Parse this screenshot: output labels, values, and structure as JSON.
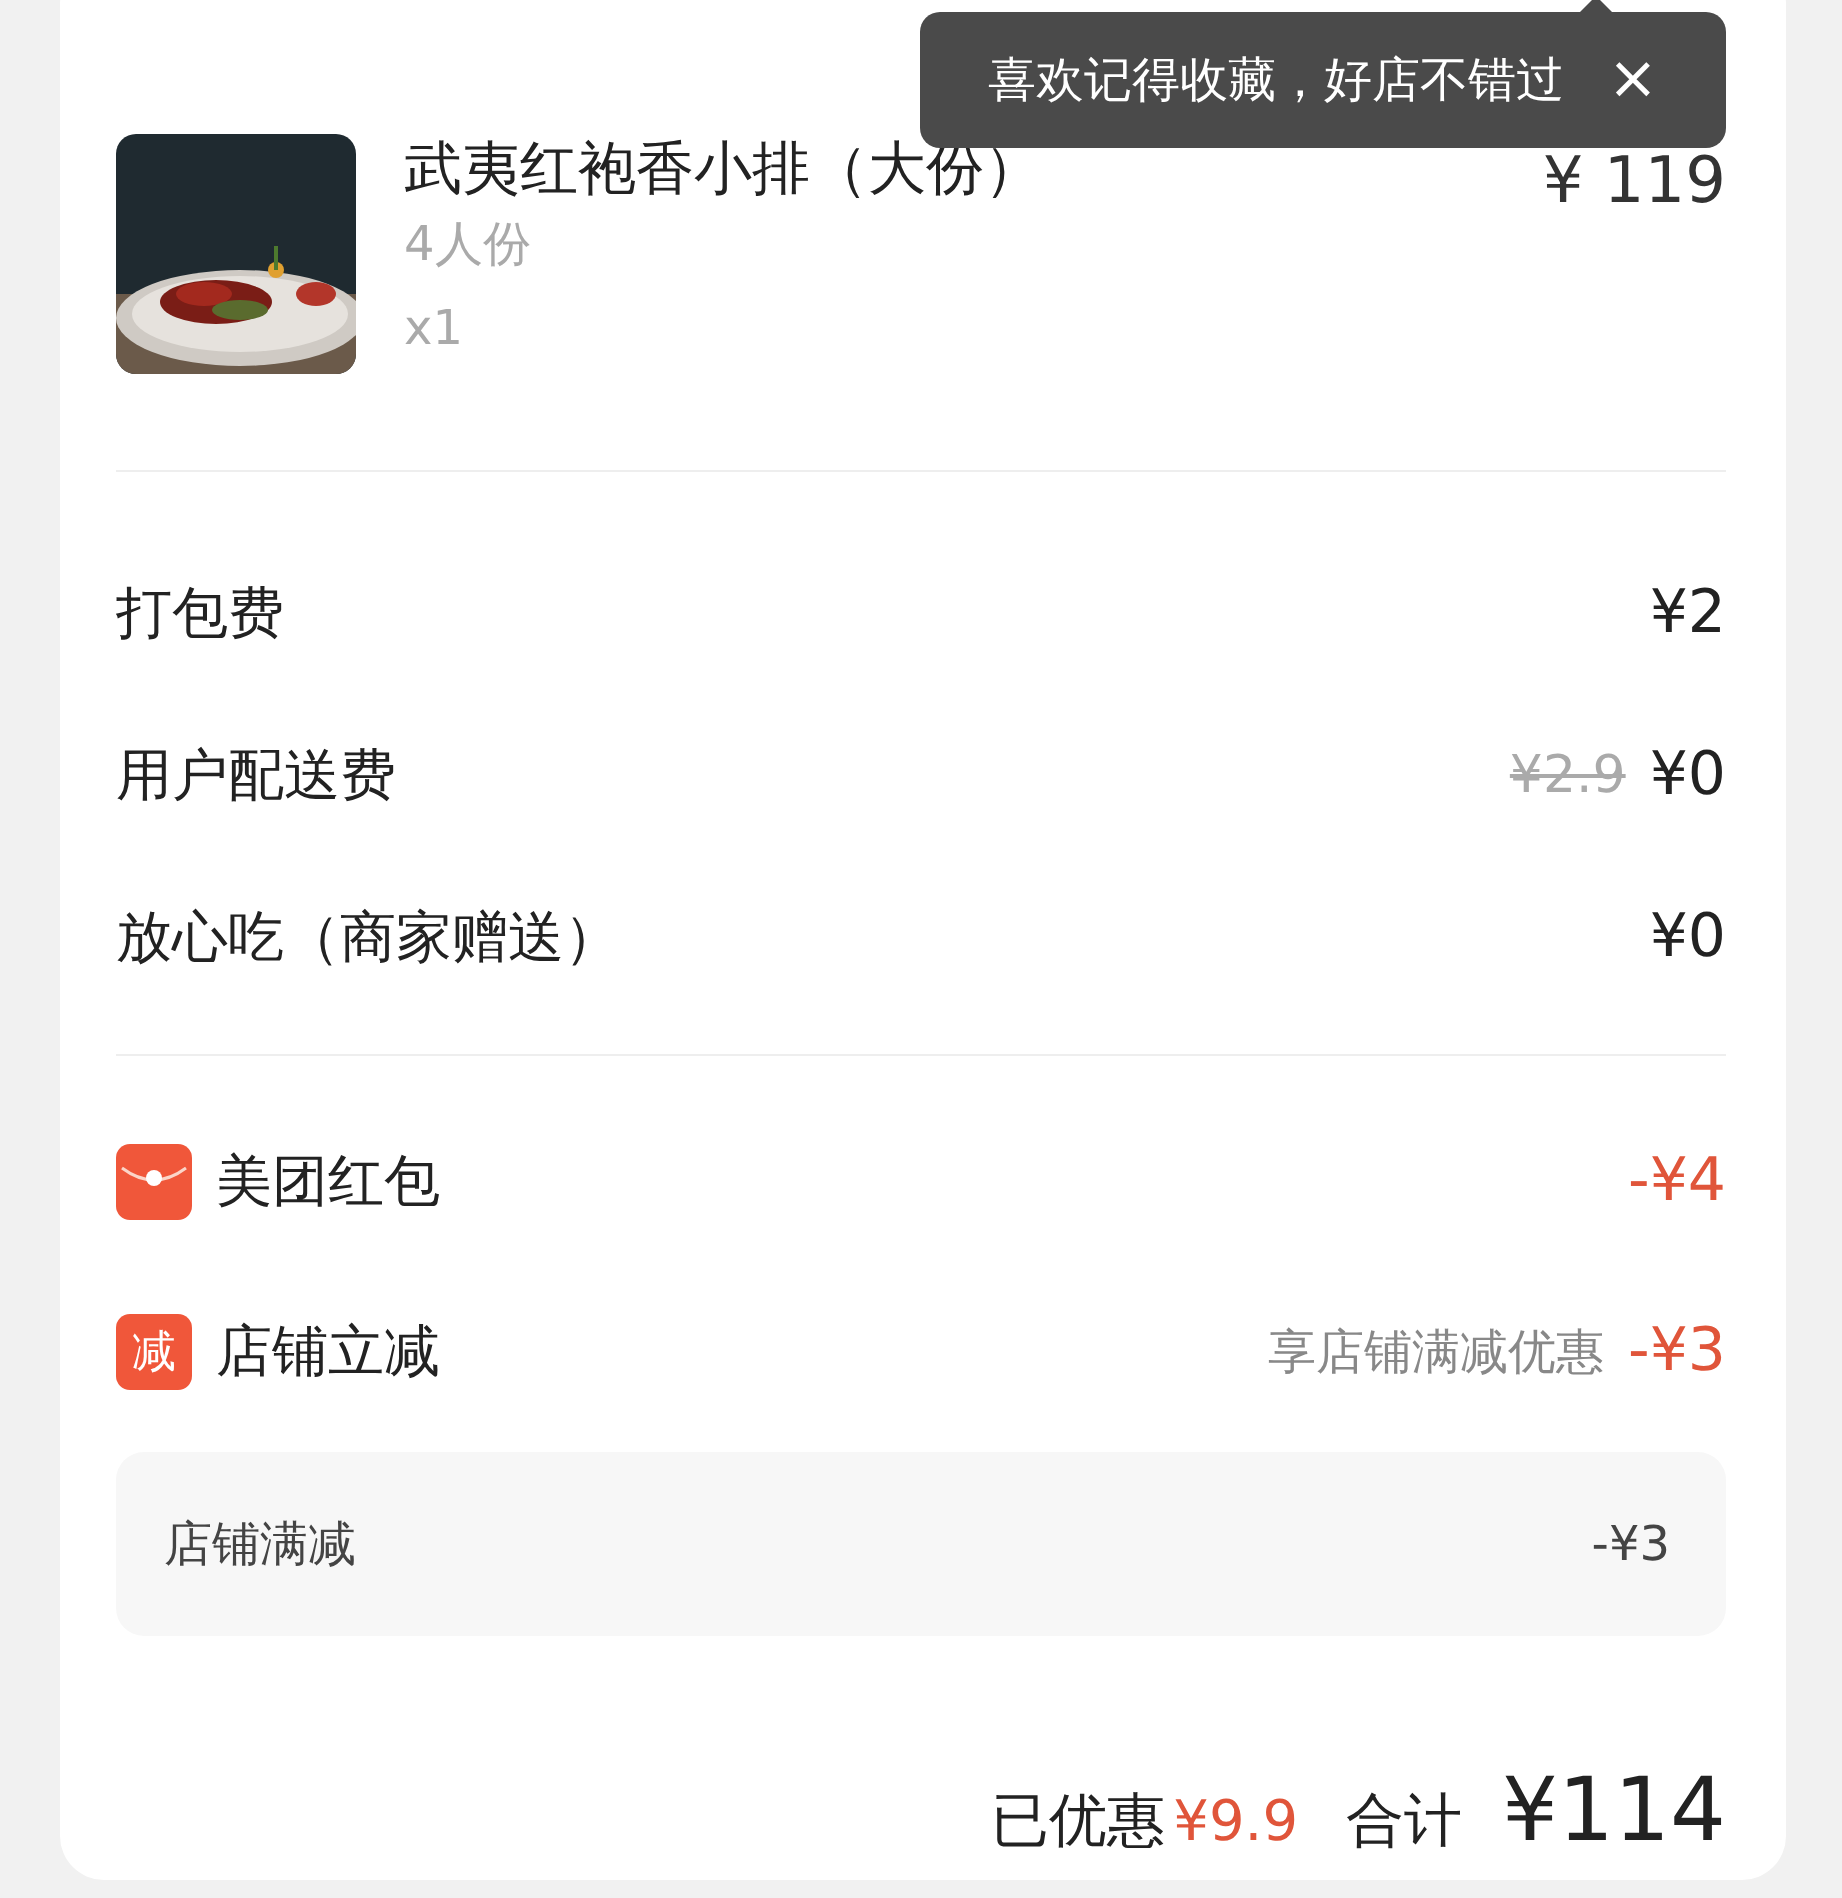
{
  "tooltip": {
    "text": "喜欢记得收藏，好店不错过",
    "close": "×"
  },
  "item": {
    "name": "武夷红袍香小排（大份）",
    "spec": "4人份",
    "quantity": "x1",
    "price": "¥ 119"
  },
  "fees": [
    {
      "label": "打包费",
      "price": "¥2"
    },
    {
      "label": "用户配送费",
      "original_price": "¥2.9",
      "price": "¥0"
    },
    {
      "label": "放心吃（商家赠送）",
      "price": "¥0"
    }
  ],
  "discounts": [
    {
      "kind": "red-packet",
      "label": "美团红包",
      "amount": "-¥4"
    },
    {
      "kind": "badge",
      "icon_text": "减",
      "label": "店铺立减",
      "note": "享店铺满减优惠",
      "amount": "-¥3"
    }
  ],
  "discount_details": [
    {
      "label": "店铺满减",
      "amount": "-¥3"
    }
  ],
  "summary": {
    "saved_label": "已优惠",
    "saved": "¥9.9",
    "total_label": "合计",
    "total": "¥114"
  }
}
